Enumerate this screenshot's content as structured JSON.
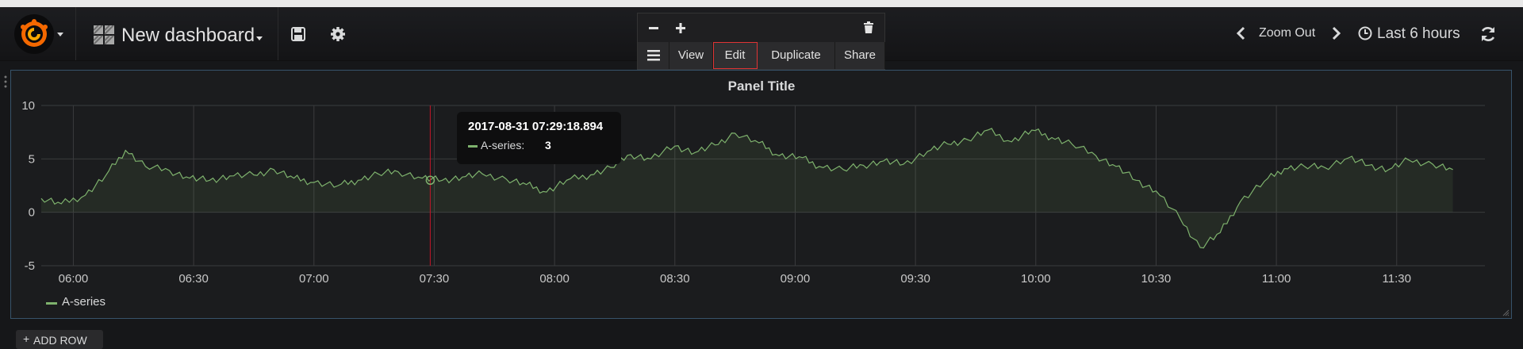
{
  "navbar": {
    "dashboard_title": "New dashboard",
    "zoom_out_label": "Zoom Out",
    "time_range_label": "Last 6 hours"
  },
  "panel_menu": {
    "items": [
      "View",
      "Edit",
      "Duplicate",
      "Share"
    ]
  },
  "panel": {
    "title": "Panel Title"
  },
  "tooltip": {
    "time": "2017-08-31 07:29:18.894",
    "series_name": "A-series:",
    "value": "3"
  },
  "add_row": {
    "label": "ADD ROW"
  },
  "colors": {
    "series": "#7eb26d",
    "accent_border": "#37536a",
    "crosshair": "#c4162a",
    "highlight": "#e03434"
  },
  "chart_data": {
    "type": "line",
    "series": [
      {
        "name": "A-series",
        "x": [
          "05:52",
          "05:57",
          "06:03",
          "06:08",
          "06:13",
          "06:18",
          "06:24",
          "06:29",
          "06:34",
          "06:39",
          "06:45",
          "06:50",
          "06:55",
          "07:00",
          "07:06",
          "07:11",
          "07:16",
          "07:21",
          "07:27",
          "07:32",
          "07:37",
          "07:42",
          "07:48",
          "07:53",
          "07:58",
          "08:03",
          "08:09",
          "08:14",
          "08:19",
          "08:24",
          "08:30",
          "08:35",
          "08:40",
          "08:45",
          "08:51",
          "08:56",
          "09:01",
          "09:06",
          "09:12",
          "09:17",
          "09:22",
          "09:27",
          "09:33",
          "09:38",
          "09:43",
          "09:48",
          "09:54",
          "09:59",
          "10:04",
          "10:09",
          "10:15",
          "10:20",
          "10:25",
          "10:30",
          "10:36",
          "10:41",
          "10:46",
          "10:51",
          "10:57",
          "11:02",
          "11:07",
          "11:12",
          "11:18",
          "11:23",
          "11:28",
          "11:33",
          "11:39",
          "11:44"
        ],
        "values": [
          1.3,
          0.8,
          1.6,
          3.4,
          5.8,
          4.3,
          3.9,
          3.2,
          3.0,
          3.4,
          3.5,
          4.0,
          3.2,
          2.8,
          2.5,
          3.0,
          3.6,
          3.8,
          3.2,
          3.0,
          3.3,
          3.6,
          3.1,
          2.6,
          1.9,
          3.0,
          3.5,
          4.2,
          5.4,
          5.0,
          6.2,
          5.6,
          6.3,
          7.4,
          6.5,
          5.3,
          5.2,
          4.3,
          4.0,
          4.4,
          4.8,
          4.5,
          5.7,
          6.4,
          6.8,
          7.7,
          6.6,
          7.7,
          7.0,
          6.4,
          5.3,
          4.3,
          3.0,
          2.0,
          -0.6,
          -3.3,
          -1.9,
          1.0,
          2.9,
          4.1,
          4.3,
          4.2,
          5.1,
          4.4,
          4.0,
          4.9,
          4.5,
          4.0
        ]
      }
    ],
    "x_ticks": [
      "06:00",
      "06:30",
      "07:00",
      "07:30",
      "08:00",
      "08:30",
      "09:00",
      "09:30",
      "10:00",
      "10:30",
      "11:00",
      "11:30"
    ],
    "y_ticks": [
      "-5",
      "0",
      "5",
      "10"
    ],
    "ylim": [
      -5,
      10
    ],
    "xlim": [
      "05:52",
      "11:52"
    ],
    "crosshair_x": "07:29",
    "grid": true,
    "fill": true,
    "legend_position": "bottom-left",
    "title": "Panel Title"
  }
}
